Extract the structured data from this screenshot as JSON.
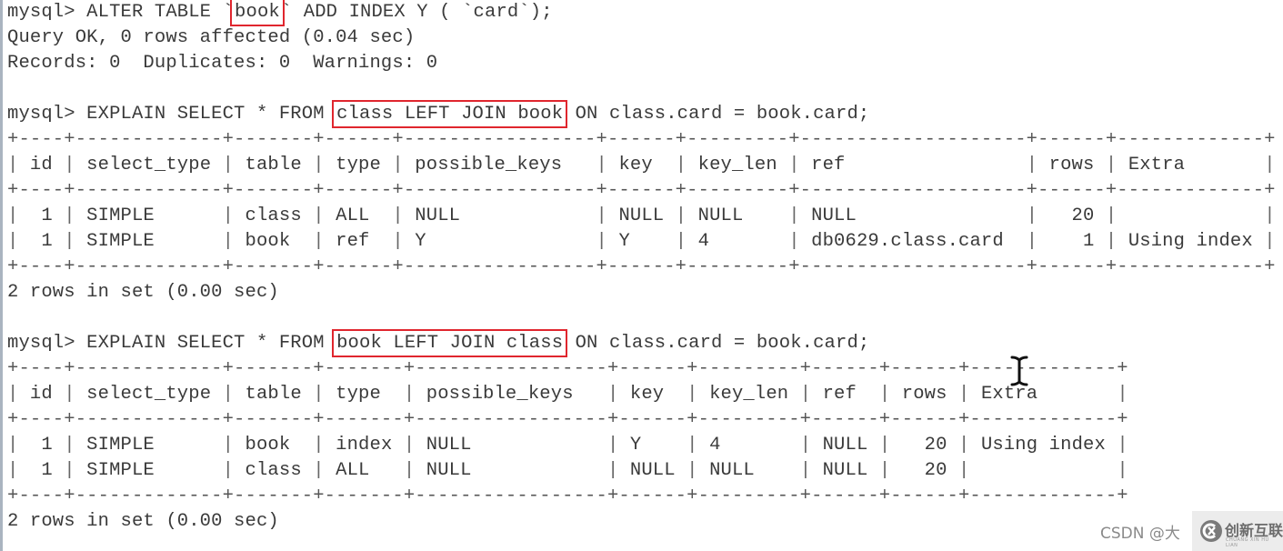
{
  "terminal": {
    "prompt": "mysql>",
    "commands": [
      {
        "id": "alter",
        "parts": [
          {
            "text": "mysql> ALTER TABLE `",
            "hl": false
          },
          {
            "text": "book",
            "hl": true
          },
          {
            "text": "` ADD INDEX Y ( `card`);",
            "hl": false
          }
        ],
        "output": [
          "Query OK, 0 rows affected (0.04 sec)",
          "Records: 0  Duplicates: 0  Warnings: 0"
        ]
      },
      {
        "id": "explain1",
        "parts": [
          {
            "text": "mysql> EXPLAIN SELECT * FROM ",
            "hl": false
          },
          {
            "text": "class LEFT JOIN book",
            "hl": true
          },
          {
            "text": " ON class.card = book.card;",
            "hl": false
          }
        ],
        "table": {
          "columns": [
            {
              "name": "id",
              "width": 4,
              "align": "right"
            },
            {
              "name": "select_type",
              "width": 13,
              "align": "left"
            },
            {
              "name": "table",
              "width": 7,
              "align": "left"
            },
            {
              "name": "type",
              "width": 6,
              "align": "left"
            },
            {
              "name": "possible_keys",
              "width": 17,
              "align": "left"
            },
            {
              "name": "key",
              "width": 6,
              "align": "left"
            },
            {
              "name": "key_len",
              "width": 9,
              "align": "left"
            },
            {
              "name": "ref",
              "width": 20,
              "align": "left"
            },
            {
              "name": "rows",
              "width": 6,
              "align": "right"
            },
            {
              "name": "Extra",
              "width": 13,
              "align": "left"
            }
          ],
          "rows": [
            [
              "1",
              "SIMPLE",
              "class",
              "ALL",
              "NULL",
              "NULL",
              "NULL",
              "NULL",
              "20",
              ""
            ],
            [
              "1",
              "SIMPLE",
              "book",
              "ref",
              "Y",
              "Y",
              "4",
              "db0629.class.card",
              "1",
              "Using index"
            ]
          ]
        },
        "footer": "2 rows in set (0.00 sec)"
      },
      {
        "id": "explain2",
        "parts": [
          {
            "text": "mysql> EXPLAIN SELECT * FROM ",
            "hl": false
          },
          {
            "text": "book LEFT JOIN class",
            "hl": true
          },
          {
            "text": " ON class.card = book.card;",
            "hl": false
          }
        ],
        "table": {
          "columns": [
            {
              "name": "id",
              "width": 4,
              "align": "right"
            },
            {
              "name": "select_type",
              "width": 13,
              "align": "left"
            },
            {
              "name": "table",
              "width": 7,
              "align": "left"
            },
            {
              "name": "type",
              "width": 7,
              "align": "left"
            },
            {
              "name": "possible_keys",
              "width": 17,
              "align": "left"
            },
            {
              "name": "key",
              "width": 6,
              "align": "left"
            },
            {
              "name": "key_len",
              "width": 9,
              "align": "left"
            },
            {
              "name": "ref",
              "width": 6,
              "align": "left"
            },
            {
              "name": "rows",
              "width": 6,
              "align": "right"
            },
            {
              "name": "Extra",
              "width": 13,
              "align": "left"
            }
          ],
          "rows": [
            [
              "1",
              "SIMPLE",
              "book",
              "index",
              "NULL",
              "Y",
              "4",
              "NULL",
              "20",
              "Using index"
            ],
            [
              "1",
              "SIMPLE",
              "class",
              "ALL",
              "NULL",
              "NULL",
              "NULL",
              "NULL",
              "20",
              ""
            ]
          ]
        },
        "footer": "2 rows in set (0.00 sec)"
      }
    ]
  },
  "cursor": {
    "icon": "text-cursor-icon"
  },
  "watermark": {
    "text": "CSDN @大",
    "brand": "创新互联",
    "brand_sub": "CHUANG XIN HU LIAN",
    "logo_icon": "brand-logo-icon"
  },
  "colors": {
    "highlight": "#e0262e",
    "text": "#3a3a3a",
    "background": "#ffffff"
  }
}
